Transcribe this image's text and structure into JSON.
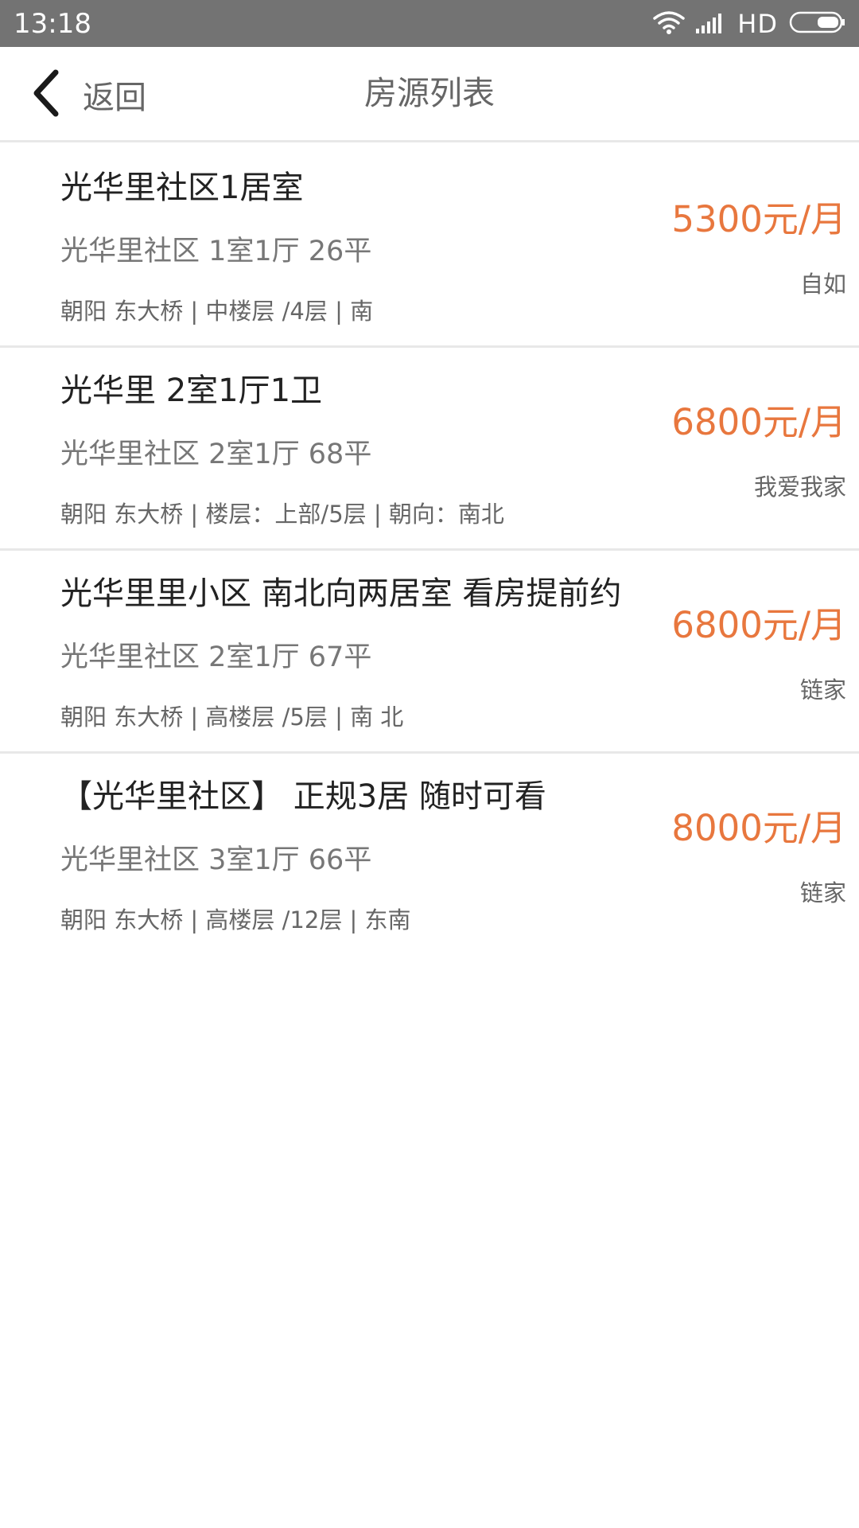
{
  "status_bar": {
    "time": "13:18",
    "network": "HD",
    "icons": [
      "wifi-icon",
      "signal-icon",
      "battery-icon"
    ]
  },
  "nav": {
    "back_label": "返回",
    "title": "房源列表",
    "back_icon": "chevron-left-icon"
  },
  "colors": {
    "status_bar_bg": "#737373",
    "price": "#e8773e",
    "title_text": "#222222",
    "secondary_text": "#777777",
    "divider": "#e8e8e8"
  },
  "listings": [
    {
      "title": "光华里社区1居室",
      "summary": "光华里社区 1室1厅 26平",
      "details": "朝阳 东大桥 | 中楼层 /4层 | 南",
      "price": "5300元/月",
      "source": "自如"
    },
    {
      "title": "光华里 2室1厅1卫",
      "summary": "光华里社区 2室1厅 68平",
      "details": "朝阳 东大桥 | 楼层：上部/5层 | 朝向：南北",
      "price": "6800元/月",
      "source": "我爱我家"
    },
    {
      "title": "光华里里小区 南北向两居室 看房提前约",
      "summary": "光华里社区 2室1厅 67平",
      "details": "朝阳 东大桥 | 高楼层 /5层 | 南 北",
      "price": "6800元/月",
      "source": "链家"
    },
    {
      "title": "【光华里社区】 正规3居 随时可看",
      "summary": "光华里社区 3室1厅 66平",
      "details": "朝阳 东大桥 | 高楼层 /12层 | 东南",
      "price": "8000元/月",
      "source": "链家"
    }
  ]
}
